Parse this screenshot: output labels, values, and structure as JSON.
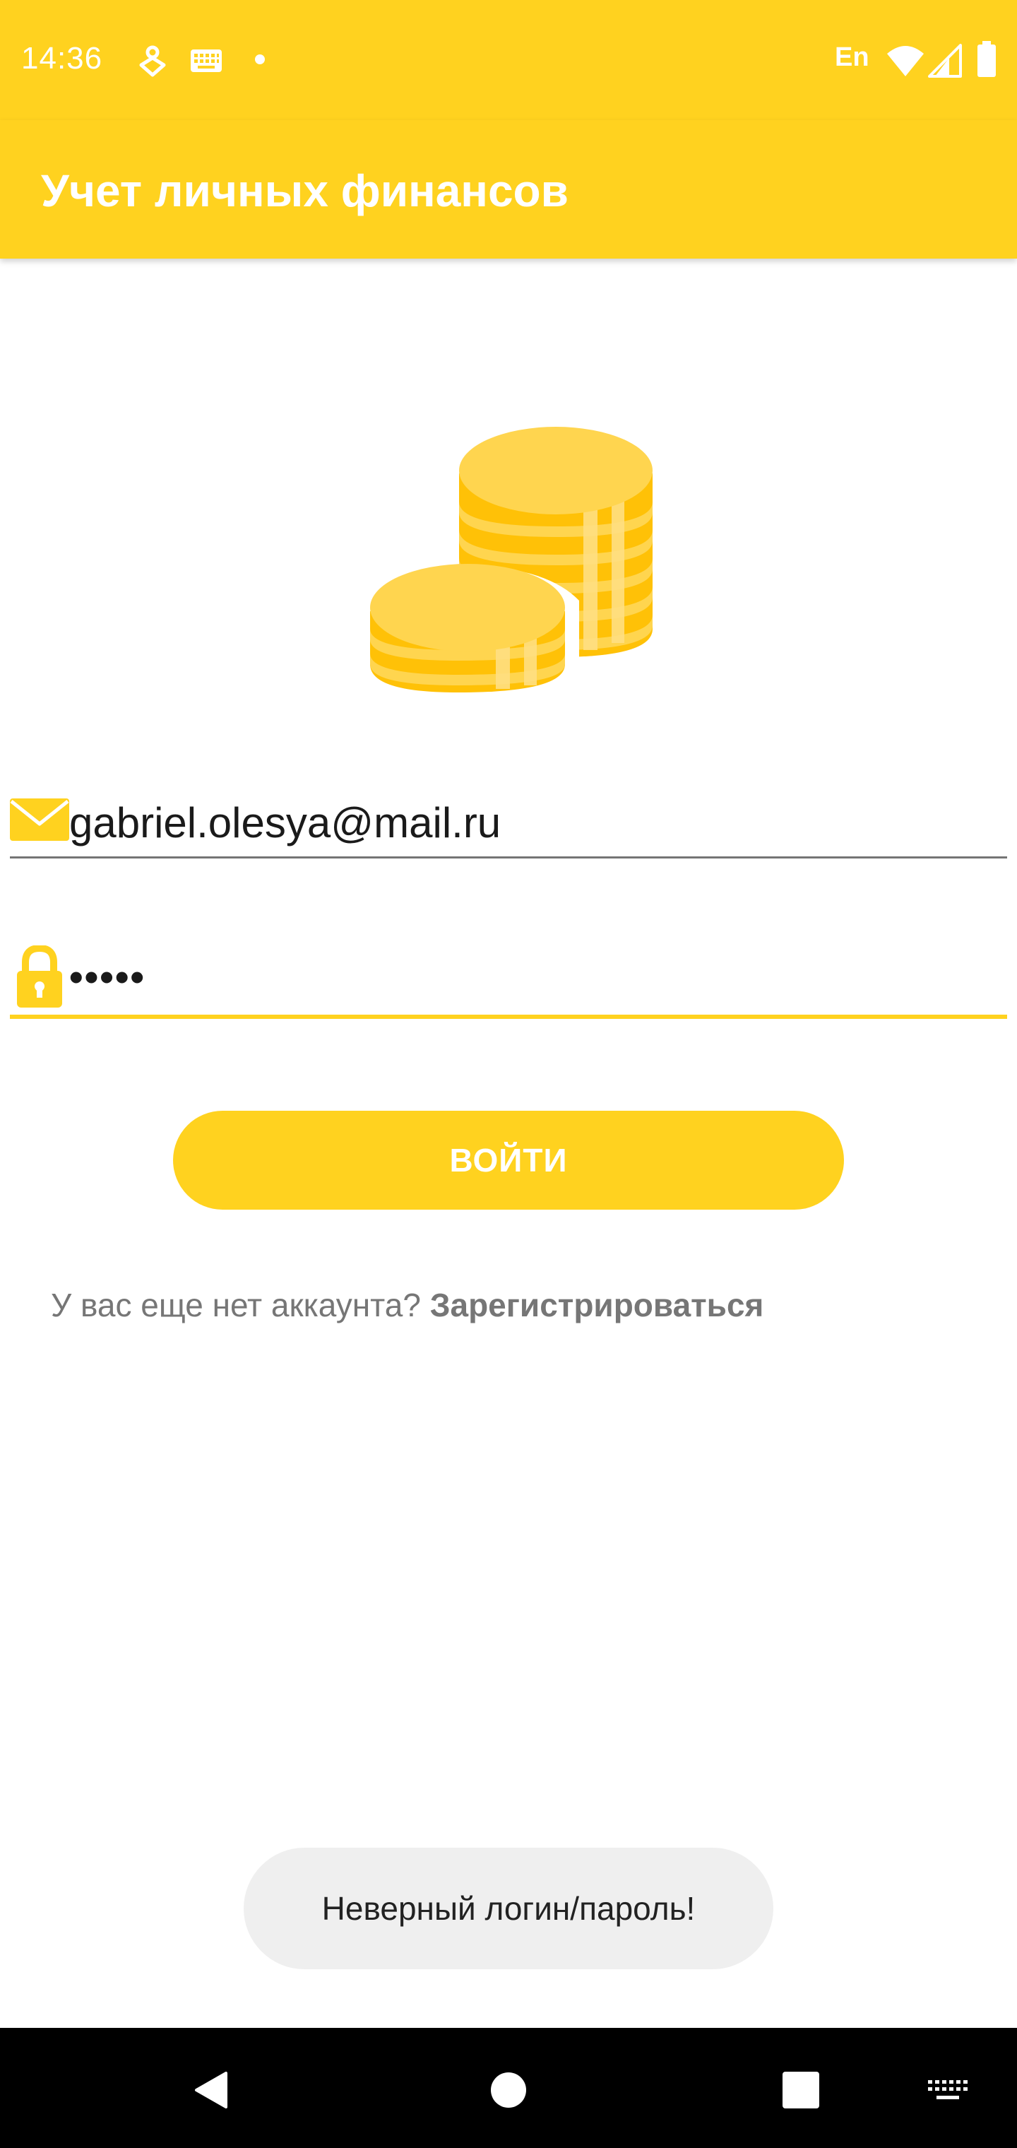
{
  "status_bar": {
    "time": "14:36",
    "language": "En",
    "icons": [
      "location-icon",
      "keyboard-icon",
      "dot-icon",
      "wifi-icon",
      "signal-icon",
      "battery-icon"
    ]
  },
  "app_bar": {
    "title": "Учет личных финансов"
  },
  "logo": {
    "icon": "coins-icon"
  },
  "login_form": {
    "email": {
      "icon": "mail-icon",
      "value": "gabriel.olesya@mail.ru"
    },
    "password": {
      "icon": "lock-icon",
      "value": "•••••"
    },
    "submit_label": "ВОЙТИ"
  },
  "register": {
    "prompt": "У вас еще нет аккаунта? ",
    "link_label": "Зарегистрироваться"
  },
  "toast": {
    "message": "Неверный логин/пароль!"
  },
  "nav_bar": {
    "buttons": [
      "back-icon",
      "home-icon",
      "recents-icon",
      "keyboard-switch-icon"
    ]
  },
  "colors": {
    "accent": "#FFD21F",
    "coin_light": "#FFD54F",
    "coin_dark": "#FFC107",
    "text_primary": "#1A1A1A",
    "text_secondary": "#767676",
    "toast_bg": "#EFEFEF",
    "nav_bg": "#000000"
  }
}
